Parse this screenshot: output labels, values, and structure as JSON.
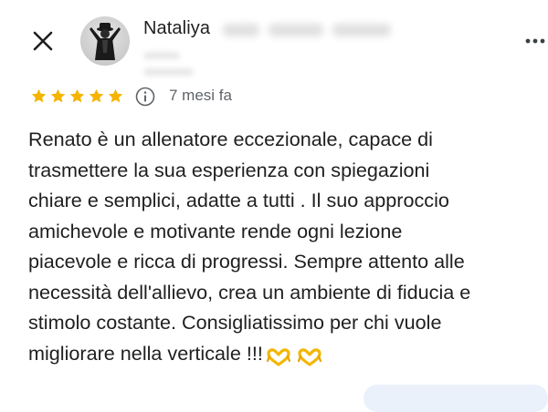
{
  "reviewer": {
    "name": "Nataliya"
  },
  "rating": {
    "stars": 5,
    "max": 5,
    "time_ago": "7 mesi fa"
  },
  "review": {
    "lines": [
      "Renato è un allenatore eccezionale, capace di",
      "trasmettere la sua esperienza con spiegazioni",
      "chiare e semplici, adatte a tutti . Il suo approccio",
      "amichevole e motivante rende ogni lezione",
      "piacevole e ricca di progressi. Sempre attento alle",
      "necessità dell'allievo, crea un ambiente di fiducia e",
      "stimolo costante. Consigliatissimo per chi vuole",
      "migliorare nella verticale !!!"
    ],
    "emoji": [
      "heart-hands",
      "heart-hands"
    ]
  },
  "icons": {
    "close": "close-icon",
    "more": "more-vert-icon",
    "info": "info-icon",
    "star": "star-icon"
  },
  "colors": {
    "star": "#f4b400",
    "text": "#1f1f1f",
    "secondary": "#5f6368",
    "pill": "#eaf1fb"
  }
}
